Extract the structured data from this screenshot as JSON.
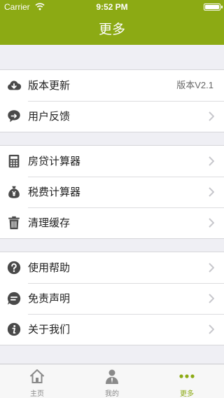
{
  "status_bar": {
    "carrier": "Carrier",
    "time": "9:52 PM",
    "battery_level": 1.0
  },
  "nav": {
    "title": "更多"
  },
  "groups": [
    {
      "items": [
        {
          "label": "版本更新",
          "value": "版本V2.1",
          "icon": "download-cloud-icon"
        },
        {
          "label": "用户反馈",
          "icon": "feedback-bubble-icon"
        }
      ]
    },
    {
      "items": [
        {
          "label": "房贷计算器",
          "icon": "calculator-icon"
        },
        {
          "label": "税费计算器",
          "icon": "money-bag-icon"
        },
        {
          "label": "清理缓存",
          "icon": "trash-icon"
        }
      ]
    },
    {
      "items": [
        {
          "label": "使用帮助",
          "icon": "question-circle-icon"
        },
        {
          "label": "免责声明",
          "icon": "message-circle-icon"
        },
        {
          "label": "关于我们",
          "icon": "info-circle-icon"
        }
      ]
    }
  ],
  "tabbar": {
    "tabs": [
      {
        "label": "主页",
        "icon": "home-icon",
        "active": false
      },
      {
        "label": "我的",
        "icon": "user-icon",
        "active": false
      },
      {
        "label": "更多",
        "icon": "more-dots-icon",
        "active": true
      }
    ]
  },
  "colors": {
    "accent": "#8caa14",
    "icon": "#4a4a4a",
    "background": "#efeff4"
  }
}
